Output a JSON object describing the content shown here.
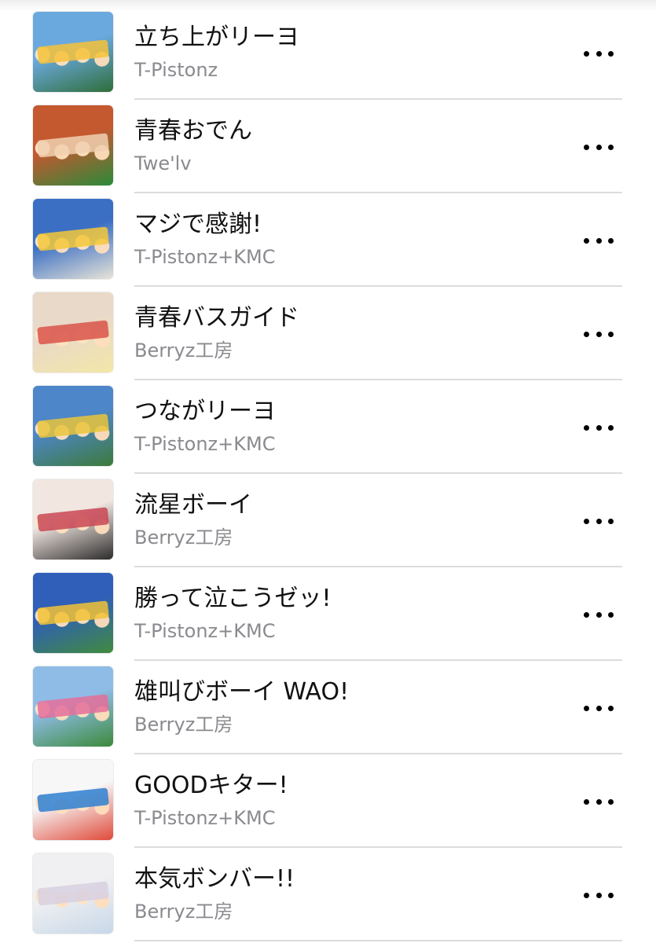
{
  "songs": [
    {
      "title": "立ち上がリーヨ",
      "artist": "T-Pistonz",
      "art_colors": [
        "#6aa9de",
        "#f6c23a",
        "#2f6e3a"
      ]
    },
    {
      "title": "青春おでん",
      "artist": "Twe'lv",
      "art_colors": [
        "#c4582f",
        "#f0d0b0",
        "#2a8a3a"
      ]
    },
    {
      "title": "マジで感謝!",
      "artist": "T-Pistonz+KMC",
      "art_colors": [
        "#3b6fc4",
        "#f3c83a",
        "#e8e4d8"
      ]
    },
    {
      "title": "青春バスガイド",
      "artist": "Berryz工房",
      "art_colors": [
        "#e9d9c8",
        "#d9544a",
        "#f2e7a8"
      ]
    },
    {
      "title": "つながリーヨ",
      "artist": "T-Pistonz+KMC",
      "art_colors": [
        "#4d86c9",
        "#e9c43b",
        "#3d7a3a"
      ]
    },
    {
      "title": "流星ボーイ",
      "artist": "Berryz工房",
      "art_colors": [
        "#f1e6e0",
        "#c94755",
        "#2c2c2c"
      ]
    },
    {
      "title": "勝って泣こうゼッ!",
      "artist": "T-Pistonz+KMC",
      "art_colors": [
        "#2f5fb8",
        "#f2c236",
        "#3f8b3e"
      ]
    },
    {
      "title": "雄叫びボーイ WAO!",
      "artist": "Berryz工房",
      "art_colors": [
        "#8fbce6",
        "#e46f9a",
        "#3b8a3b"
      ]
    },
    {
      "title": "GOODキター!",
      "artist": "T-Pistonz+KMC",
      "art_colors": [
        "#f7f7f7",
        "#2f7fd0",
        "#e04a3a"
      ]
    },
    {
      "title": "本気ボンバー!!",
      "artist": "Berryz工房",
      "art_colors": [
        "#f0f0f2",
        "#d8d0e0",
        "#c8d8e8"
      ]
    }
  ],
  "more_icon": "ellipsis-icon"
}
